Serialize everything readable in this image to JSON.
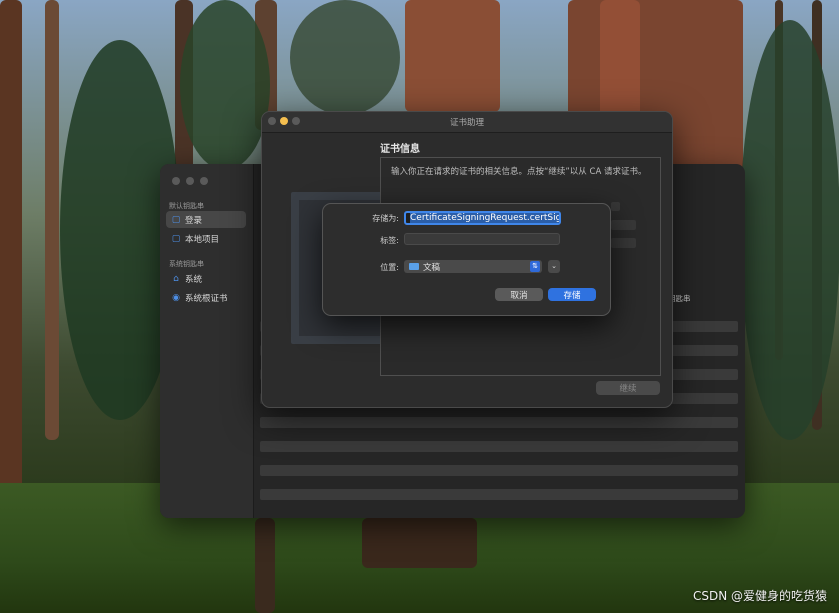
{
  "keychain": {
    "section_default": "默认钥匙串",
    "section_system": "系统钥匙串",
    "items": [
      {
        "label": "登录",
        "icon": "keychain-icon",
        "selected": true
      },
      {
        "label": "本地项目",
        "icon": "keychain-icon",
        "selected": false
      },
      {
        "label": "系统",
        "icon": "lock-icon",
        "selected": false
      },
      {
        "label": "系统根证书",
        "icon": "certificate-icon",
        "selected": false
      }
    ],
    "column_header": "钥匙串"
  },
  "assistant": {
    "title": "证书助理",
    "heading": "证书信息",
    "description": "输入你正在请求的证书的相关信息。点按“继续”以从 CA 请求证书。",
    "continue_label": "继续"
  },
  "save_sheet": {
    "save_as_label": "存储为:",
    "save_as_value": "CertificateSigningRequest.certSigni",
    "tags_label": "标签:",
    "tags_value": "",
    "location_label": "位置:",
    "location_value": "文稿",
    "location_icon": "folder-icon",
    "cancel_label": "取消",
    "save_label": "存储"
  },
  "watermark": "CSDN @爱健身的吃货猿",
  "colors": {
    "accent": "#2f72e0",
    "window_bg": "#2c2c2c",
    "traffic_close": "#5a5a5a",
    "traffic_minimize": "#f5bf4f"
  }
}
